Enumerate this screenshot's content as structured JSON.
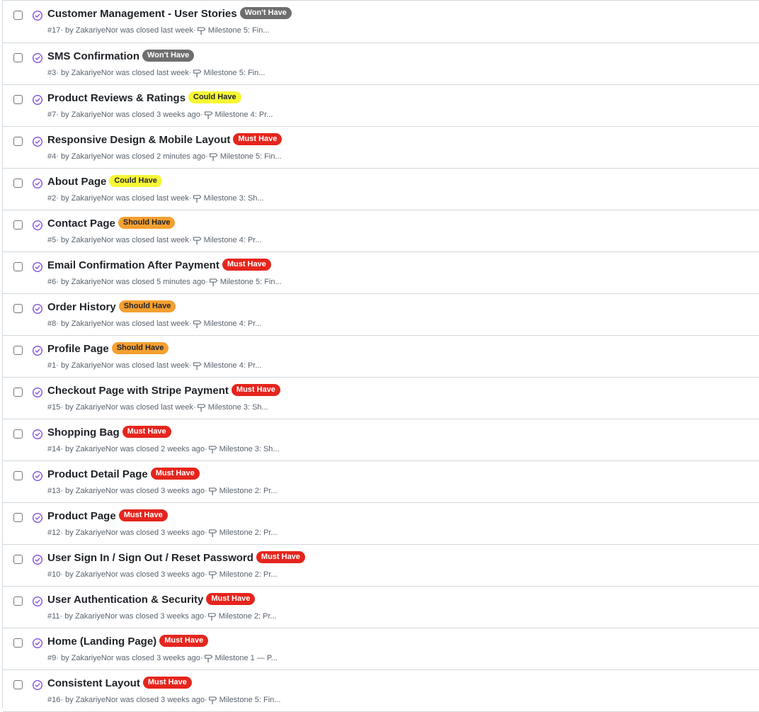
{
  "colors": {
    "must_have": "#e5251d",
    "should_have": "#f5a030",
    "could_have": "#f7f736",
    "wont_have": "#6e6e6e",
    "closed_icon": "#8250df"
  },
  "issues": [
    {
      "title": "Customer Management - User Stories",
      "label": "Won't Have",
      "label_type": "wont_have",
      "number": "#17",
      "meta": " · by ZakariyeNor was closed last week·",
      "milestone": "Milestone 5: Fin..."
    },
    {
      "title": "SMS Confirmation",
      "label": "Won't Have",
      "label_type": "wont_have",
      "number": "#3",
      "meta": " · by ZakariyeNor was closed last week·",
      "milestone": "Milestone 5: Fin..."
    },
    {
      "title": "Product Reviews & Ratings",
      "label": "Could Have",
      "label_type": "could_have",
      "number": "#7",
      "meta": " · by ZakariyeNor was closed 3 weeks ago·",
      "milestone": "Milestone 4: Pr..."
    },
    {
      "title": "Responsive Design & Mobile Layout",
      "label": "Must Have",
      "label_type": "must_have",
      "number": "#4",
      "meta": " · by ZakariyeNor was closed 2 minutes ago·",
      "milestone": "Milestone 5: Fin..."
    },
    {
      "title": "About Page",
      "label": "Could Have",
      "label_type": "could_have",
      "number": "#2",
      "meta": " · by ZakariyeNor was closed last week·",
      "milestone": "Milestone 3: Sh..."
    },
    {
      "title": "Contact Page",
      "label": "Should Have",
      "label_type": "should_have",
      "number": "#5",
      "meta": " · by ZakariyeNor was closed last week·",
      "milestone": "Milestone 4: Pr..."
    },
    {
      "title": "Email Confirmation After Payment",
      "label": "Must Have",
      "label_type": "must_have",
      "number": "#6",
      "meta": " · by ZakariyeNor was closed 5 minutes ago·",
      "milestone": "Milestone 5: Fin..."
    },
    {
      "title": "Order History",
      "label": "Should Have",
      "label_type": "should_have",
      "number": "#8",
      "meta": " · by ZakariyeNor was closed last week·",
      "milestone": "Milestone 4: Pr..."
    },
    {
      "title": "Profile Page",
      "label": "Should Have",
      "label_type": "should_have",
      "number": "#1",
      "meta": " · by ZakariyeNor was closed last week·",
      "milestone": "Milestone 4: Pr..."
    },
    {
      "title": "Checkout Page with Stripe Payment",
      "label": "Must Have",
      "label_type": "must_have",
      "number": "#15",
      "meta": " · by ZakariyeNor was closed last week·",
      "milestone": "Milestone 3: Sh..."
    },
    {
      "title": "Shopping Bag",
      "label": "Must Have",
      "label_type": "must_have",
      "number": "#14",
      "meta": " · by ZakariyeNor was closed 2 weeks ago·",
      "milestone": "Milestone 3: Sh..."
    },
    {
      "title": "Product Detail Page",
      "label": "Must Have",
      "label_type": "must_have",
      "number": "#13",
      "meta": " · by ZakariyeNor was closed 3 weeks ago·",
      "milestone": "Milestone 2: Pr..."
    },
    {
      "title": "Product Page",
      "label": "Must Have",
      "label_type": "must_have",
      "number": "#12",
      "meta": " · by ZakariyeNor was closed 3 weeks ago·",
      "milestone": "Milestone 2: Pr..."
    },
    {
      "title": "User Sign In / Sign Out / Reset Password",
      "label": "Must Have",
      "label_type": "must_have",
      "number": "#10",
      "meta": " · by ZakariyeNor was closed 3 weeks ago·",
      "milestone": "Milestone 2: Pr..."
    },
    {
      "title": "User Authentication & Security",
      "label": "Must Have",
      "label_type": "must_have",
      "number": "#11",
      "meta": " · by ZakariyeNor was closed 3 weeks ago·",
      "milestone": "Milestone 2: Pr..."
    },
    {
      "title": "Home (Landing Page)",
      "label": "Must Have",
      "label_type": "must_have",
      "number": "#9",
      "meta": " · by ZakariyeNor was closed 3 weeks ago·",
      "milestone": "Milestone 1 — P..."
    },
    {
      "title": "Consistent Layout",
      "label": "Must Have",
      "label_type": "must_have",
      "number": "#16",
      "meta": " · by ZakariyeNor was closed 3 weeks ago·",
      "milestone": "Milestone 5: Fin..."
    }
  ]
}
